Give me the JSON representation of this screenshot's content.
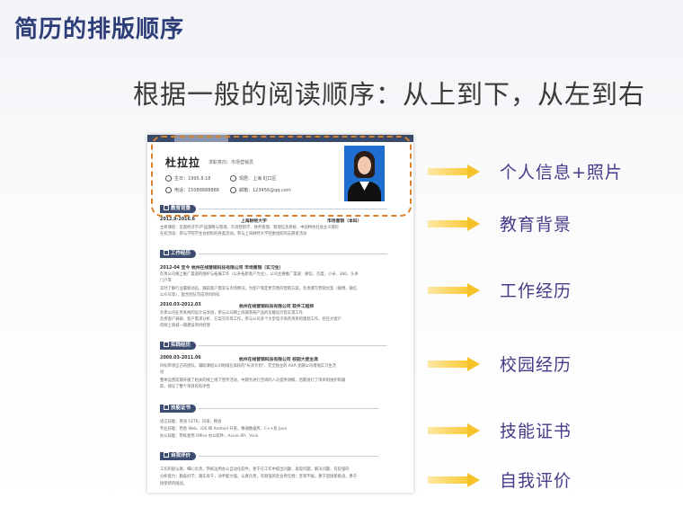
{
  "slide": {
    "title": "简历的排版顺序",
    "subtitle": "根据一般的阅读顺序：从上到下，从左到右"
  },
  "resume": {
    "name": "杜拉拉",
    "intent": "求职意向：市场营销员",
    "info": {
      "birth": "生日：1995.8.18",
      "origin": "现居：上海 虹口区",
      "phone": "电话：15088888888",
      "email": "邮箱：123456@qq.com"
    },
    "sections": {
      "education": "教育背景",
      "work": "工作经历",
      "practice": "实践经历",
      "skills": "技能证书",
      "self_eval": "自我评价"
    },
    "education": {
      "date": "2012.9-2016.6",
      "school": "上海财经大学",
      "major": "市场营销（本科）",
      "line1": "主修课程：宏观经济学/产品策略与管理、市场营销学、财务管理、管理信息系统、中国特色社会主义理论",
      "line2": "在校活动：参与学院学生会组织的各类活动，参与上海财经大学团委组织的志愿者活动"
    },
    "work": {
      "job1_title": "2012-04 至今 杭州在线营销科技有限公司 市场营销（实习生）",
      "job1_line1": "负责公司线上推广渠道的维护与拓展工作（以开拓新客户为主），公司主要推广渠道：微信、百度、小米、360、头条",
      "job1_line2": "门户等",
      "job1_line3": "实时了解行业最新动态，跟踪客户需求与市场情况，为客户制定更完善的营销方案，负责撰写营销文案（微博、微信",
      "job1_line4": "公众号等），配合团队完成项目目标",
      "job2_date": "2010.03-2012.03",
      "job2_company": "杭州在线营销科技有限公司 软件工程师",
      "job2_line1": "负责公司业务系统的设计与改进，参与公司网上商城系统产品的功能设计及实现工作",
      "job2_line2": "负责客户调研、客户需求分析、方案写作等工作，参与公司多个大型电子商务项目的策划工作，担任大客户",
      "job2_line3": "的网上商城一期建设项目经理"
    },
    "practice": {
      "date": "2009.03-2011.06",
      "company": "杭州在线营销科技有限公司 校园大使主席",
      "line1": "目标带领自己的团队，辅助课程公司地域在高校的\"长龙计划\"，完全独立的 AXA 金融公司增值实习生活",
      "line2": "动",
      "line3": "整体运营前期开展了相关的线上线下宣传活动，中期为进行咨询的人员提供讲解，后期进行了项目的维护和跟",
      "line4": "踪，保证了整个项目的有序性"
    },
    "skills": {
      "line1": "语言技能：英语 CET6，日语，韩语",
      "line2": "专业技能：熟悉 Web、iOS 和 Android 开发，精通数据库、C++及 Java",
      "line3": "办公技能：熟练使用 Office 办公软件，Axure RP、Visio"
    },
    "self_eval": {
      "line1": "工作积极认真，细心负责，熟练运用办公自动化软件，善于在工作中提出问题、发现问题、解决问题，有较强的",
      "line2": "分析能力；勤奋好学，踏实肯干，动手能力强，认真负责，有很强的社会责任感；坚韧不拔，勇于迎接新挑战，勇于",
      "line3": "接受新的挑战。"
    }
  },
  "labels": [
    "个人信息+照片",
    "教育背景",
    "工作经历",
    "校园经历",
    "技能证书",
    "自我评价"
  ],
  "colors": {
    "title": "#2c3d77",
    "section_pill": "#3d4e72",
    "highlight_frame": "#d9822b",
    "arrow": "#f5c229",
    "label": "#4a3a8a"
  }
}
